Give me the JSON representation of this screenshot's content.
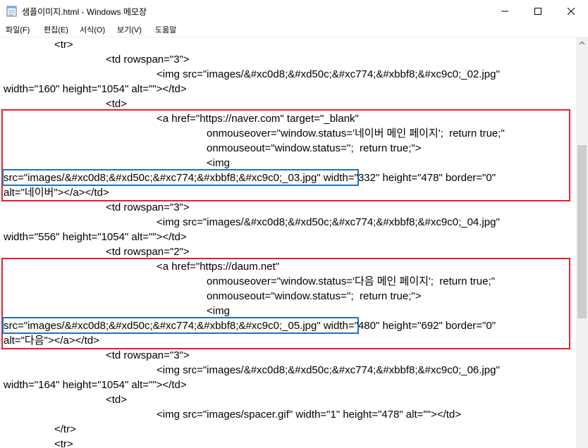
{
  "window": {
    "title": "샘플이미지.html - Windows 메모장",
    "icon": "notepad-icon"
  },
  "menu": [
    "파일(F)",
    "편집(E)",
    "서식(O)",
    "보기(V)",
    "도움말"
  ],
  "editor": {
    "lines": [
      "<tr>",
      "<td rowspan=\"3\">",
      "<img src=\"images/&#xc0d8;&#xd50c;&#xc774;&#xbbf8;&#xc9c0;_02.jpg\"",
      "width=\"160\" height=\"1054\" alt=\"\"></td>",
      "<td>",
      "<a href=\"https://naver.com\" target=\"_blank\"",
      "onmouseover=\"window.status='네이버 메인 페이지';  return true;\"",
      "onmouseout=\"window.status='';  return true;\">",
      "<img",
      "src=\"images/&#xc0d8;&#xd50c;&#xc774;&#xbbf8;&#xc9c0;_03.jpg\" width=\"332\" height=\"478\" border=\"0\"",
      "alt=\"네이버\"></a></td>",
      "<td rowspan=\"3\">",
      "<img src=\"images/&#xc0d8;&#xd50c;&#xc774;&#xbbf8;&#xc9c0;_04.jpg\"",
      "width=\"556\" height=\"1054\" alt=\"\"></td>",
      "<td rowspan=\"2\">",
      "<a href=\"https://daum.net\"",
      "onmouseover=\"window.status='다음 메인 페이지';  return true;\"",
      "onmouseout=\"window.status='';  return true;\">",
      "<img",
      "src=\"images/&#xc0d8;&#xd50c;&#xc774;&#xbbf8;&#xc9c0;_05.jpg\" width=\"480\" height=\"692\" border=\"0\"",
      "alt=\"다음\"></a></td>",
      "<td rowspan=\"3\">",
      "<img src=\"images/&#xc0d8;&#xd50c;&#xc774;&#xbbf8;&#xc9c0;_06.jpg\"",
      "width=\"164\" height=\"1054\" alt=\"\"></td>",
      "<td>",
      "<img src=\"images/spacer.gif\" width=\"1\" height=\"478\" alt=\"\"></td>",
      "</tr>",
      "<tr>"
    ]
  },
  "colors": {
    "highlight_red": "#e8202a",
    "highlight_blue": "#1e73be"
  }
}
